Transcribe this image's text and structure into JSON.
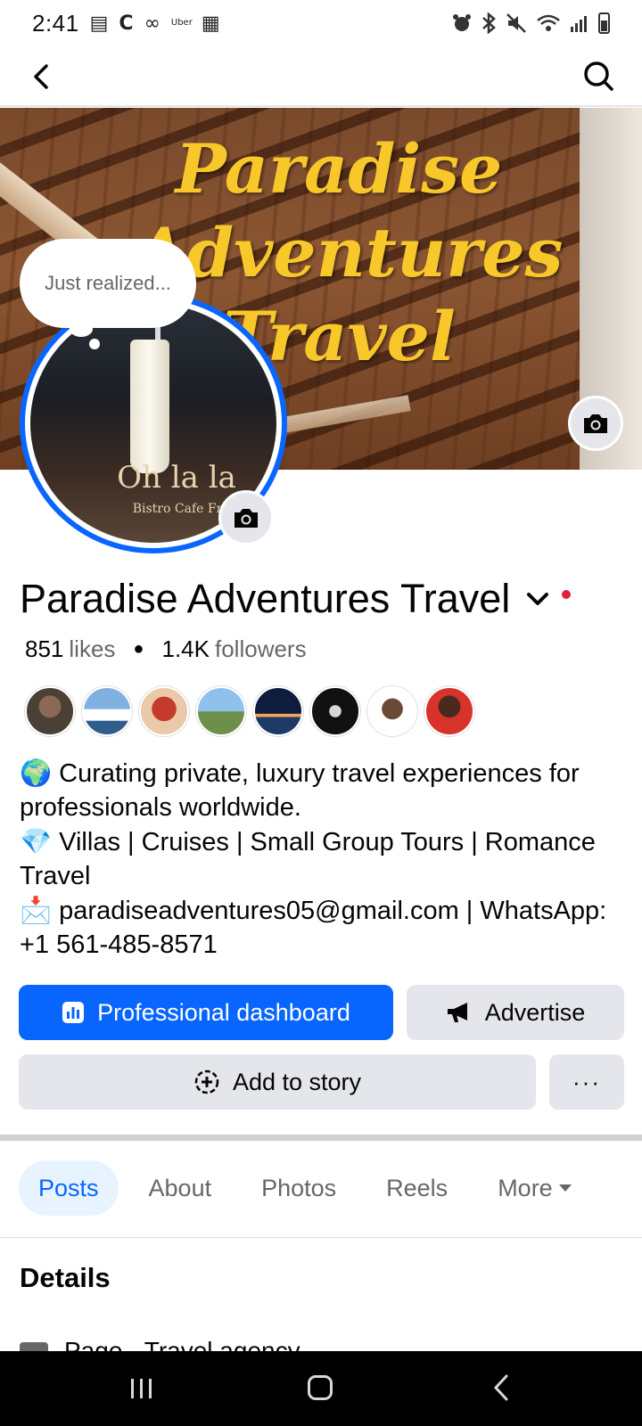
{
  "status_bar": {
    "time": "2:41",
    "left_icons": [
      "bag-icon",
      "c-icon",
      "voicemail-icon",
      "uber-icon",
      "gallery-icon"
    ],
    "uber_text": "Uber",
    "right_icons": [
      "alarm-icon",
      "bluetooth-icon",
      "mute-icon",
      "wifi-icon",
      "signal-icon",
      "battery-icon"
    ]
  },
  "nav": {
    "back_icon": "back-arrow-icon",
    "search_icon": "search-icon"
  },
  "cover": {
    "title_lines": [
      "Paradise",
      "Adventures",
      "Travel"
    ],
    "camera_icon": "camera-icon"
  },
  "profile": {
    "thought_bubble": "Just realized...",
    "photo_sign": "Oh la la",
    "photo_sign_small": "Bistro Cafe Fr",
    "camera_icon": "camera-icon"
  },
  "page": {
    "name": "Paradise Adventures Travel",
    "likes_count": "851",
    "likes_label": "likes",
    "followers_count": "1.4K",
    "followers_label": "followers",
    "follower_avatars": 8
  },
  "bio": {
    "line1_emoji": "🌍",
    "line1": "Curating private, luxury travel experiences for professionals worldwide.",
    "line2_emoji": "💎",
    "line2": "Villas | Cruises | Small Group Tours | Romance Travel",
    "line3_emoji": "📩",
    "line3": "paradiseadventures05@gmail.com | WhatsApp: +1 561-485-8571"
  },
  "buttons": {
    "professional_dashboard": "Professional dashboard",
    "advertise": "Advertise",
    "add_to_story": "Add to story",
    "more": "···"
  },
  "tabs": [
    "Posts",
    "About",
    "Photos",
    "Reels",
    "More"
  ],
  "details": {
    "title": "Details",
    "row": "Page · Travel agency"
  },
  "colors": {
    "accent": "#0866ff",
    "secondary_button": "#e4e6eb",
    "muted_text": "#65676b",
    "cover_title": "#f8c82b",
    "notification_dot": "#e41e3f"
  }
}
